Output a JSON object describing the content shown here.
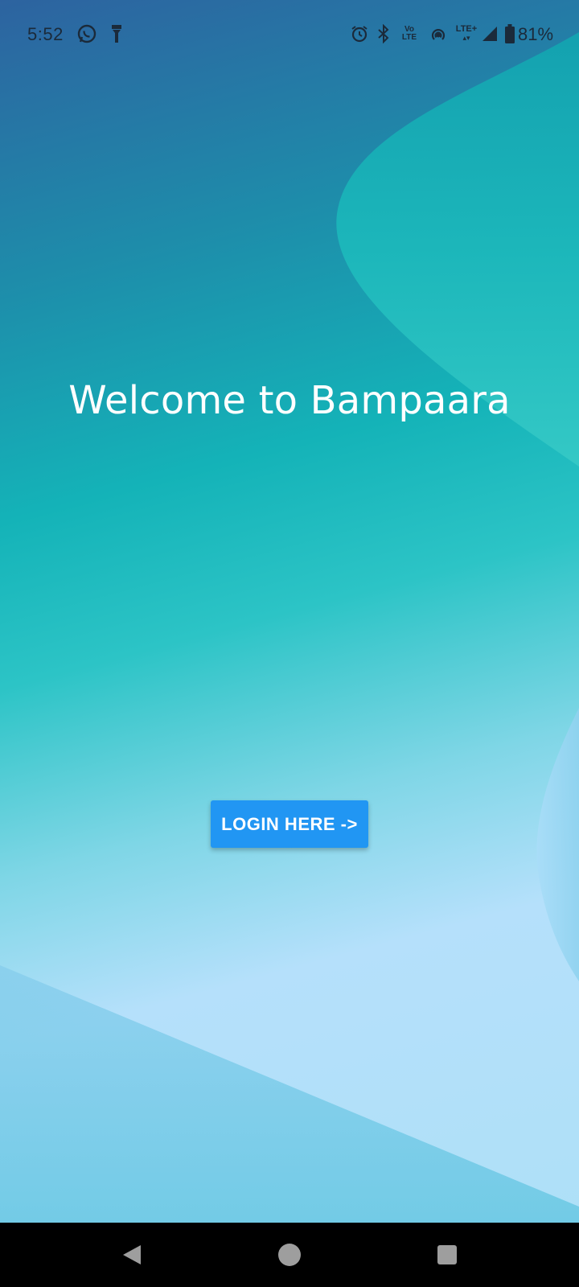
{
  "status_bar": {
    "time": "5:52",
    "battery": "81%",
    "icons": [
      "whatsapp-icon",
      "flashlight-icon",
      "alarm-icon",
      "bluetooth-icon",
      "volte-icon",
      "hotspot-icon",
      "lte-plus-icon",
      "signal-icon",
      "battery-icon"
    ],
    "volte_label_top": "Vo",
    "volte_label_bottom": "LTE",
    "lte_plus_label": "LTE+"
  },
  "main": {
    "welcome_text": "Welcome to Bampaara",
    "login_button_label": "LOGIN HERE ->"
  },
  "nav_bar": {
    "icons": [
      "back-icon",
      "home-icon",
      "recents-icon"
    ]
  },
  "colors": {
    "button": "#2196f3",
    "text": "#ffffff",
    "nav_bar": "#000000"
  }
}
